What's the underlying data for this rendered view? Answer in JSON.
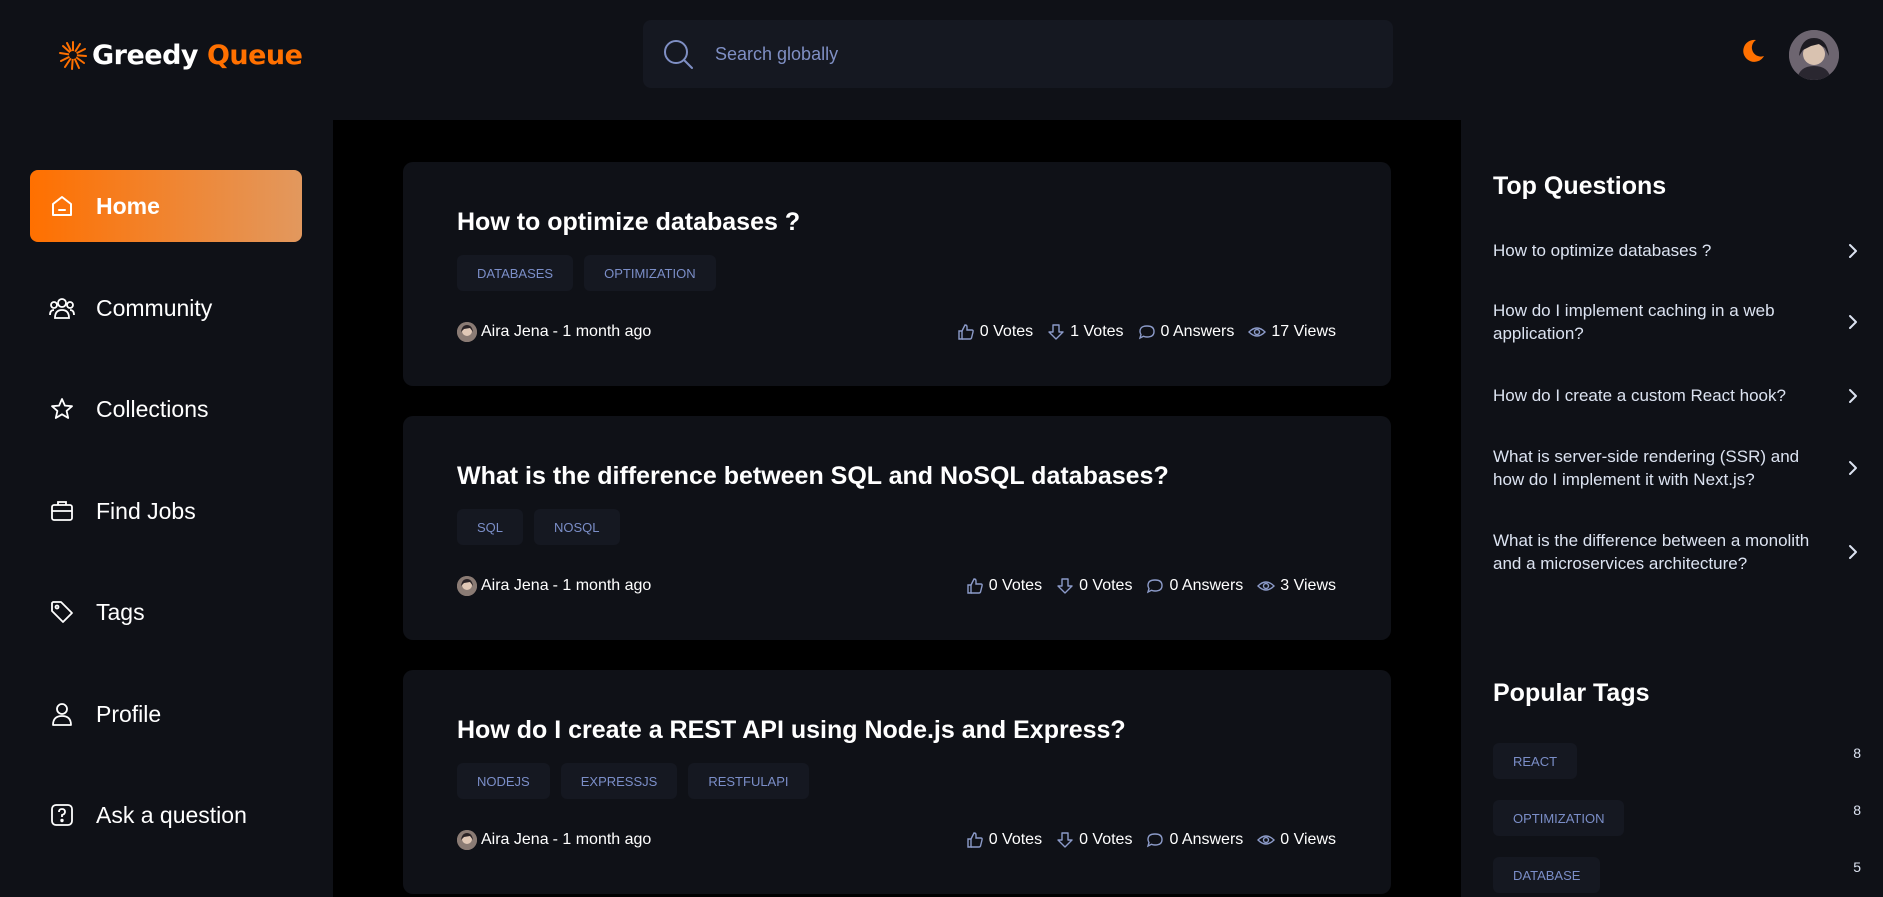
{
  "brand": {
    "name_part1": "Greedy",
    "name_part2": "Queue"
  },
  "search": {
    "placeholder": "Search globally"
  },
  "sidebar": {
    "items": [
      {
        "label": "Home",
        "icon": "home-icon",
        "active": true
      },
      {
        "label": "Community",
        "icon": "users-icon"
      },
      {
        "label": "Collections",
        "icon": "star-icon"
      },
      {
        "label": "Find Jobs",
        "icon": "briefcase-icon"
      },
      {
        "label": "Tags",
        "icon": "tag-icon"
      },
      {
        "label": "Profile",
        "icon": "user-icon"
      },
      {
        "label": "Ask a question",
        "icon": "question-icon"
      }
    ]
  },
  "questions": [
    {
      "title": "How to optimize databases ?",
      "tags": [
        "DATABASES",
        "OPTIMIZATION"
      ],
      "author": "Aira Jena",
      "time": " - 1 month ago",
      "upvotes": "0 Votes",
      "downvotes": "1 Votes",
      "answers": "0 Answers",
      "views": "17 Views"
    },
    {
      "title": "What is the difference between SQL and NoSQL databases?",
      "tags": [
        "SQL",
        "NOSQL"
      ],
      "author": "Aira Jena",
      "time": " - 1 month ago",
      "upvotes": "0 Votes",
      "downvotes": "0 Votes",
      "answers": "0 Answers",
      "views": "3 Views"
    },
    {
      "title": "How do I create a REST API using Node.js and Express?",
      "tags": [
        "NODEJS",
        "EXPRESSJS",
        "RESTFULAPI"
      ],
      "author": "Aira Jena",
      "time": " - 1 month ago",
      "upvotes": "0 Votes",
      "downvotes": "0 Votes",
      "answers": "0 Answers",
      "views": "0 Views"
    }
  ],
  "top_questions": {
    "heading": "Top Questions",
    "items": [
      "How to optimize databases ?",
      "How do I implement caching in a web application?",
      "How do I create a custom React hook?",
      "What is server-side rendering (SSR) and how do I implement it with Next.js?",
      "What is the difference between a monolith and a microservices architecture?"
    ]
  },
  "popular_tags": {
    "heading": "Popular Tags",
    "items": [
      {
        "name": "REACT",
        "count": "8"
      },
      {
        "name": "OPTIMIZATION",
        "count": "8"
      },
      {
        "name": "DATABASE",
        "count": "5"
      }
    ]
  },
  "colors": {
    "accent": "#ff7000",
    "background": "#0f1117",
    "main_bg": "#000000",
    "tag_text": "#7b8ec8"
  }
}
